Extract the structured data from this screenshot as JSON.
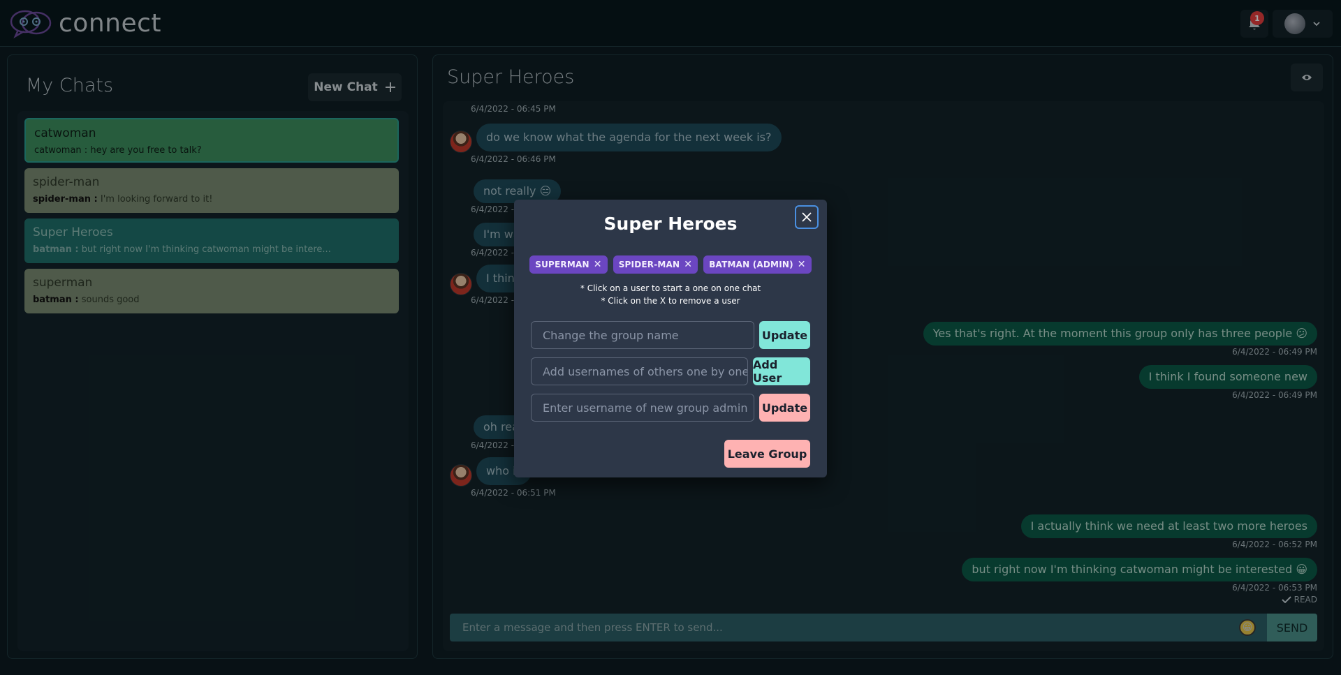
{
  "app": {
    "name": "connect",
    "notification_count": "1"
  },
  "left": {
    "title": "My Chats",
    "new_chat_label": "New Chat",
    "chats": [
      {
        "name": "catwoman",
        "sender": "catwoman :",
        "preview": "hey are you free to talk?"
      },
      {
        "name": "spider-man",
        "sender": "spider-man :",
        "preview": "I'm looking forward to it!"
      },
      {
        "name": "Super Heroes",
        "sender": "batman :",
        "preview": "but right now I'm thinking catwoman might be intere..."
      },
      {
        "name": "superman",
        "sender": "batman :",
        "preview": "sounds good"
      }
    ]
  },
  "chat": {
    "title": "Super Heroes",
    "messages": [
      {
        "text": "",
        "time": "6/4/2022 - 06:45 PM"
      },
      {
        "text": "do we know what the agenda for the next week is?",
        "time": "6/4/2022 - 06:46 PM"
      },
      {
        "text": "not really 😑",
        "time": "6/4/2022 - 06:47 PM"
      },
      {
        "text": "I'm wa",
        "time": "6/4/2022 - 06:47 PM"
      },
      {
        "text": "I think",
        "time": "6/4/2022 - 06:48 PM"
      },
      {
        "text": "Yes that's right. At the moment this group only has three people 😕",
        "time": "6/4/2022 - 06:49 PM"
      },
      {
        "text": "I think I found someone new",
        "time": "6/4/2022 - 06:49 PM"
      },
      {
        "text": "oh rea",
        "time": "6/4/2022 - 06:50 PM"
      },
      {
        "text": "who is",
        "time": "6/4/2022 - 06:51 PM"
      },
      {
        "text": "I actually think we need at least two more heroes",
        "time": "6/4/2022 - 06:52 PM"
      },
      {
        "text": "but right now I'm thinking catwoman might be interested 😀",
        "time": "6/4/2022 - 06:53 PM"
      }
    ],
    "read_label": "READ",
    "input_placeholder": "Enter a message and then press ENTER to send...",
    "send_label": "SEND"
  },
  "modal": {
    "title": "Super Heroes",
    "members": [
      "SUPERMAN",
      "SPIDER-MAN",
      "BATMAN (ADMIN)"
    ],
    "hint1": "* Click on a user to start a one on one chat",
    "hint2": "* Click on the X to remove a user",
    "rename_placeholder": "Change the group name",
    "rename_button": "Update",
    "add_placeholder": "Add usernames of others one by one",
    "add_button": "Add User",
    "admin_placeholder": "Enter username of new group admin",
    "admin_button": "Update",
    "leave_button": "Leave Group"
  },
  "colors": {
    "accent": "#81e6d9",
    "danger": "#feb2b2",
    "tag": "#6b46c1"
  }
}
